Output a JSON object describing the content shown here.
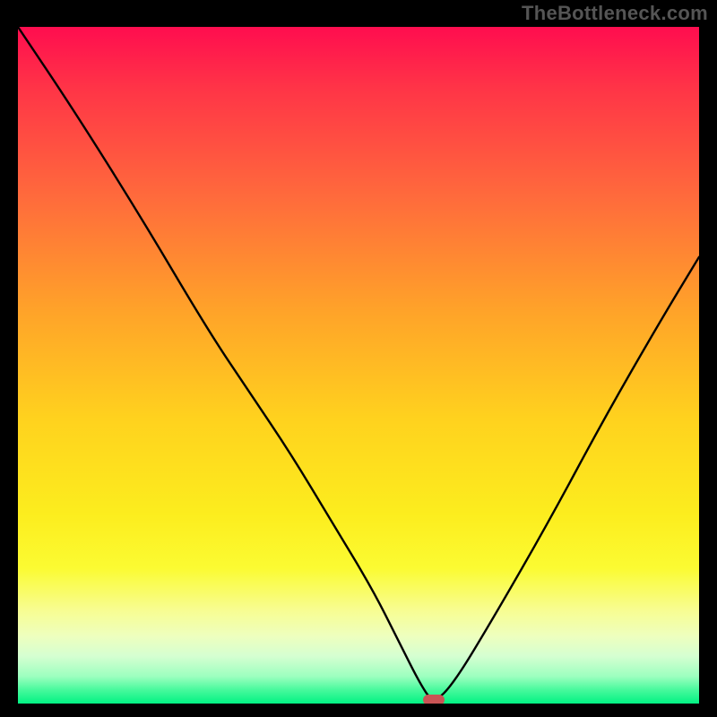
{
  "watermark": "TheBottleneck.com",
  "colors": {
    "background": "#000000",
    "curve": "#000000",
    "marker": "#c95455",
    "gradient_top": "#ff0d4f",
    "gradient_mid": "#fced1e",
    "gradient_bottom": "#02f283"
  },
  "chart_data": {
    "type": "line",
    "title": "",
    "xlabel": "",
    "ylabel": "",
    "xlim": [
      0,
      100
    ],
    "ylim": [
      0,
      100
    ],
    "annotations": [
      {
        "name": "optimal-marker",
        "x": 61,
        "y": 0
      }
    ],
    "series": [
      {
        "name": "bottleneck-curve",
        "x": [
          0,
          8,
          18,
          28,
          34,
          40,
          46,
          52,
          56,
          59,
          61,
          64,
          70,
          78,
          86,
          94,
          100
        ],
        "values": [
          100,
          88,
          72,
          55,
          46,
          37,
          27,
          17,
          9,
          3,
          0,
          3,
          13,
          27,
          42,
          56,
          66
        ]
      }
    ]
  }
}
